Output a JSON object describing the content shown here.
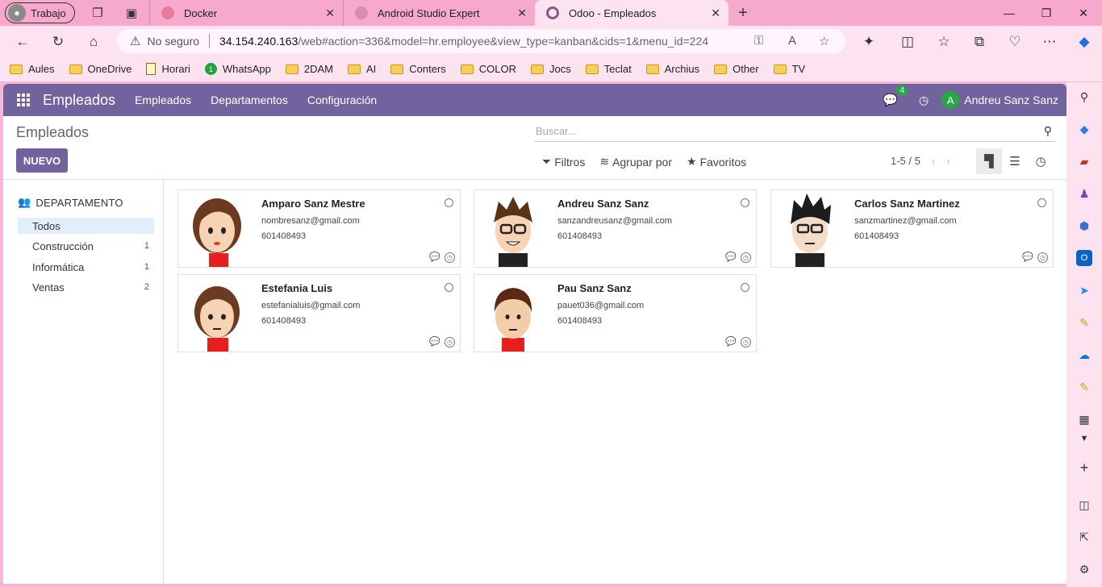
{
  "browser": {
    "profile_label": "Trabajo",
    "tabs": [
      {
        "label": "Docker",
        "favicon_color": "#e37c9f"
      },
      {
        "label": "Android Studio Expert",
        "favicon_color": "#d98bb2"
      },
      {
        "label": "Odoo - Empleados",
        "favicon_color": "#8b5a83"
      }
    ],
    "address": {
      "security_label": "No seguro",
      "host": "34.154.240.163",
      "path": "/web#action=336&model=hr.employee&view_type=kanban&cids=1&menu_id=224"
    },
    "bookmarks": [
      {
        "label": "Aules",
        "icon": "folder-icon"
      },
      {
        "label": "OneDrive",
        "icon": "folder-icon"
      },
      {
        "label": "Horari",
        "icon": "document-icon"
      },
      {
        "label": "WhatsApp",
        "icon": "whatsapp-icon"
      },
      {
        "label": "2DAM",
        "icon": "folder-icon"
      },
      {
        "label": "AI",
        "icon": "folder-icon"
      },
      {
        "label": "Conters",
        "icon": "folder-icon"
      },
      {
        "label": "COLOR",
        "icon": "folder-icon"
      },
      {
        "label": "Jocs",
        "icon": "folder-icon"
      },
      {
        "label": "Teclat",
        "icon": "folder-icon"
      },
      {
        "label": "Archius",
        "icon": "folder-icon"
      },
      {
        "label": "Other",
        "icon": "folder-icon"
      },
      {
        "label": "TV",
        "icon": "folder-icon"
      }
    ]
  },
  "odoo": {
    "app_title": "Empleados",
    "menu": [
      "Empleados",
      "Departamentos",
      "Configuración"
    ],
    "messages_count": "4",
    "user_initial": "A",
    "user_name": "Andreu Sanz Sanz",
    "accent_color": "#71639e"
  },
  "control_panel": {
    "breadcrumb": "Empleados",
    "new_button": "NUEVO",
    "search_placeholder": "Buscar...",
    "filters_label": "Filtros",
    "group_by_label": "Agrupar por",
    "favorites_label": "Favoritos",
    "pager": "1-5 / 5"
  },
  "sidebar": {
    "header": "DEPARTAMENTO",
    "items": [
      {
        "label": "Todos",
        "count": ""
      },
      {
        "label": "Construcción",
        "count": "1"
      },
      {
        "label": "Informática",
        "count": "1"
      },
      {
        "label": "Ventas",
        "count": "2"
      }
    ]
  },
  "employees": [
    {
      "name": "Amparo Sanz Mestre",
      "email": "nombresanz@gmail.com",
      "phone": "601408493",
      "avatar": "female-avatar"
    },
    {
      "name": "Andreu Sanz Sanz",
      "email": "sanzandreusanz@gmail.com",
      "phone": "601408493",
      "avatar": "male-glasses-avatar"
    },
    {
      "name": "Carlos Sanz Martinez",
      "email": "sanzmartinez@gmail.com",
      "phone": "601408493",
      "avatar": "male-glasses-spiky-avatar"
    },
    {
      "name": "Estefania Luis",
      "email": "estefanialuis@gmail.com",
      "phone": "601408493",
      "avatar": "female-avatar"
    },
    {
      "name": "Pau Sanz Sanz",
      "email": "pauet036@gmail.com",
      "phone": "601408493",
      "avatar": "male-avatar"
    }
  ]
}
